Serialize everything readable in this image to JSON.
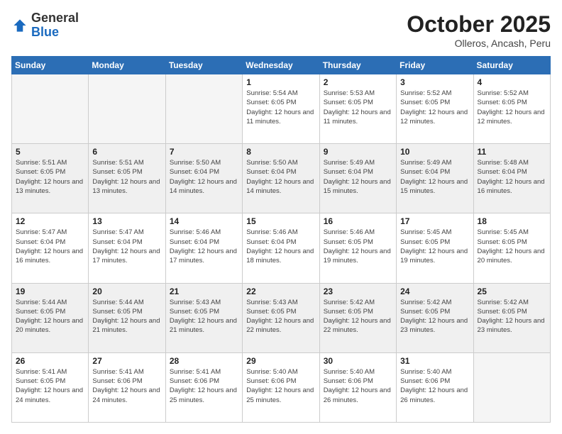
{
  "header": {
    "logo_general": "General",
    "logo_blue": "Blue",
    "month_year": "October 2025",
    "location": "Olleros, Ancash, Peru"
  },
  "weekdays": [
    "Sunday",
    "Monday",
    "Tuesday",
    "Wednesday",
    "Thursday",
    "Friday",
    "Saturday"
  ],
  "weeks": [
    [
      {
        "day": "",
        "detail": ""
      },
      {
        "day": "",
        "detail": ""
      },
      {
        "day": "",
        "detail": ""
      },
      {
        "day": "1",
        "detail": "Sunrise: 5:54 AM\nSunset: 6:05 PM\nDaylight: 12 hours\nand 11 minutes."
      },
      {
        "day": "2",
        "detail": "Sunrise: 5:53 AM\nSunset: 6:05 PM\nDaylight: 12 hours\nand 11 minutes."
      },
      {
        "day": "3",
        "detail": "Sunrise: 5:52 AM\nSunset: 6:05 PM\nDaylight: 12 hours\nand 12 minutes."
      },
      {
        "day": "4",
        "detail": "Sunrise: 5:52 AM\nSunset: 6:05 PM\nDaylight: 12 hours\nand 12 minutes."
      }
    ],
    [
      {
        "day": "5",
        "detail": "Sunrise: 5:51 AM\nSunset: 6:05 PM\nDaylight: 12 hours\nand 13 minutes."
      },
      {
        "day": "6",
        "detail": "Sunrise: 5:51 AM\nSunset: 6:05 PM\nDaylight: 12 hours\nand 13 minutes."
      },
      {
        "day": "7",
        "detail": "Sunrise: 5:50 AM\nSunset: 6:04 PM\nDaylight: 12 hours\nand 14 minutes."
      },
      {
        "day": "8",
        "detail": "Sunrise: 5:50 AM\nSunset: 6:04 PM\nDaylight: 12 hours\nand 14 minutes."
      },
      {
        "day": "9",
        "detail": "Sunrise: 5:49 AM\nSunset: 6:04 PM\nDaylight: 12 hours\nand 15 minutes."
      },
      {
        "day": "10",
        "detail": "Sunrise: 5:49 AM\nSunset: 6:04 PM\nDaylight: 12 hours\nand 15 minutes."
      },
      {
        "day": "11",
        "detail": "Sunrise: 5:48 AM\nSunset: 6:04 PM\nDaylight: 12 hours\nand 16 minutes."
      }
    ],
    [
      {
        "day": "12",
        "detail": "Sunrise: 5:47 AM\nSunset: 6:04 PM\nDaylight: 12 hours\nand 16 minutes."
      },
      {
        "day": "13",
        "detail": "Sunrise: 5:47 AM\nSunset: 6:04 PM\nDaylight: 12 hours\nand 17 minutes."
      },
      {
        "day": "14",
        "detail": "Sunrise: 5:46 AM\nSunset: 6:04 PM\nDaylight: 12 hours\nand 17 minutes."
      },
      {
        "day": "15",
        "detail": "Sunrise: 5:46 AM\nSunset: 6:04 PM\nDaylight: 12 hours\nand 18 minutes."
      },
      {
        "day": "16",
        "detail": "Sunrise: 5:46 AM\nSunset: 6:05 PM\nDaylight: 12 hours\nand 19 minutes."
      },
      {
        "day": "17",
        "detail": "Sunrise: 5:45 AM\nSunset: 6:05 PM\nDaylight: 12 hours\nand 19 minutes."
      },
      {
        "day": "18",
        "detail": "Sunrise: 5:45 AM\nSunset: 6:05 PM\nDaylight: 12 hours\nand 20 minutes."
      }
    ],
    [
      {
        "day": "19",
        "detail": "Sunrise: 5:44 AM\nSunset: 6:05 PM\nDaylight: 12 hours\nand 20 minutes."
      },
      {
        "day": "20",
        "detail": "Sunrise: 5:44 AM\nSunset: 6:05 PM\nDaylight: 12 hours\nand 21 minutes."
      },
      {
        "day": "21",
        "detail": "Sunrise: 5:43 AM\nSunset: 6:05 PM\nDaylight: 12 hours\nand 21 minutes."
      },
      {
        "day": "22",
        "detail": "Sunrise: 5:43 AM\nSunset: 6:05 PM\nDaylight: 12 hours\nand 22 minutes."
      },
      {
        "day": "23",
        "detail": "Sunrise: 5:42 AM\nSunset: 6:05 PM\nDaylight: 12 hours\nand 22 minutes."
      },
      {
        "day": "24",
        "detail": "Sunrise: 5:42 AM\nSunset: 6:05 PM\nDaylight: 12 hours\nand 23 minutes."
      },
      {
        "day": "25",
        "detail": "Sunrise: 5:42 AM\nSunset: 6:05 PM\nDaylight: 12 hours\nand 23 minutes."
      }
    ],
    [
      {
        "day": "26",
        "detail": "Sunrise: 5:41 AM\nSunset: 6:05 PM\nDaylight: 12 hours\nand 24 minutes."
      },
      {
        "day": "27",
        "detail": "Sunrise: 5:41 AM\nSunset: 6:06 PM\nDaylight: 12 hours\nand 24 minutes."
      },
      {
        "day": "28",
        "detail": "Sunrise: 5:41 AM\nSunset: 6:06 PM\nDaylight: 12 hours\nand 25 minutes."
      },
      {
        "day": "29",
        "detail": "Sunrise: 5:40 AM\nSunset: 6:06 PM\nDaylight: 12 hours\nand 25 minutes."
      },
      {
        "day": "30",
        "detail": "Sunrise: 5:40 AM\nSunset: 6:06 PM\nDaylight: 12 hours\nand 26 minutes."
      },
      {
        "day": "31",
        "detail": "Sunrise: 5:40 AM\nSunset: 6:06 PM\nDaylight: 12 hours\nand 26 minutes."
      },
      {
        "day": "",
        "detail": ""
      }
    ]
  ]
}
